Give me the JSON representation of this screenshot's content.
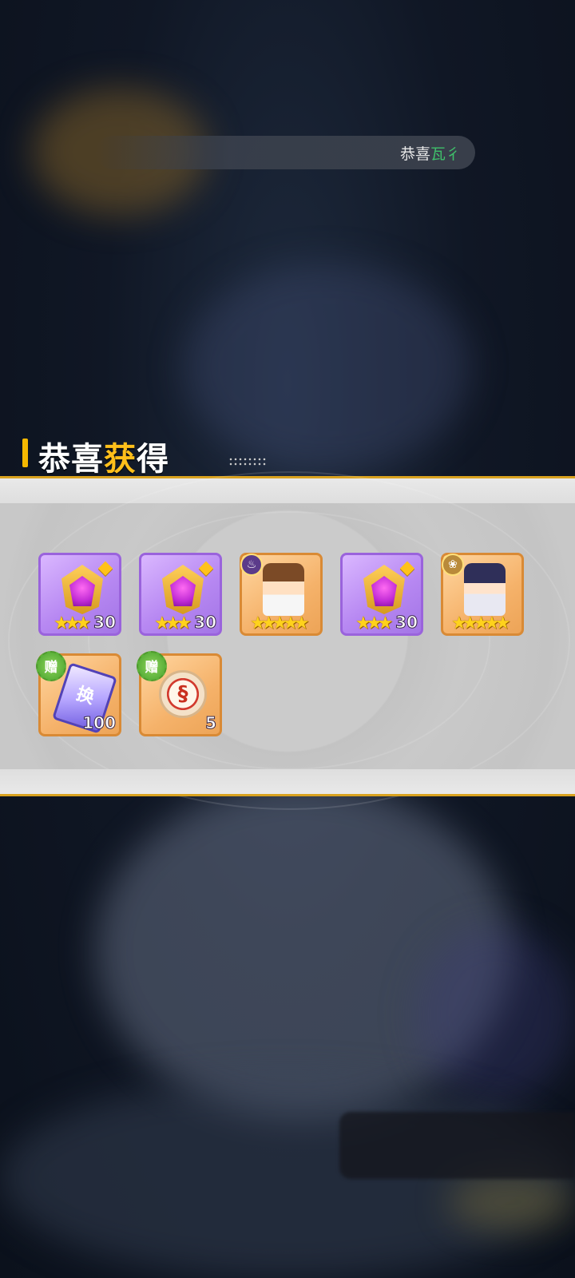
{
  "marquee": {
    "prefix": "恭喜",
    "highlight": "瓦彳"
  },
  "title": {
    "part1": "恭喜",
    "part2": "获",
    "part3": "得"
  },
  "rewards": [
    {
      "type": "gem",
      "frame": "purple",
      "count": "30",
      "stars": "★★★",
      "tag": "gem-corner-icon"
    },
    {
      "type": "gem",
      "frame": "purple",
      "count": "30",
      "stars": "★★★",
      "tag": "gem-corner-icon"
    },
    {
      "type": "hero",
      "frame": "orange",
      "stars": "★★★★★",
      "badge": "♨"
    },
    {
      "type": "gem",
      "frame": "purple",
      "count": "30",
      "stars": "★★★",
      "tag": "gem-corner-icon"
    },
    {
      "type": "hero",
      "frame": "orange",
      "stars": "★★★★★",
      "badge": "❀"
    },
    {
      "type": "ticket",
      "frame": "orange",
      "count": "100",
      "gift_label": "赠",
      "glyph": "换"
    },
    {
      "type": "token",
      "frame": "orange",
      "count": "5",
      "gift_label": "赠",
      "glyph": "§"
    }
  ],
  "colors": {
    "accent_gold": "#f5b800",
    "highlight_green": "#3fbf6a",
    "purple_frame": "#9a63dc",
    "orange_frame": "#d98a35"
  }
}
